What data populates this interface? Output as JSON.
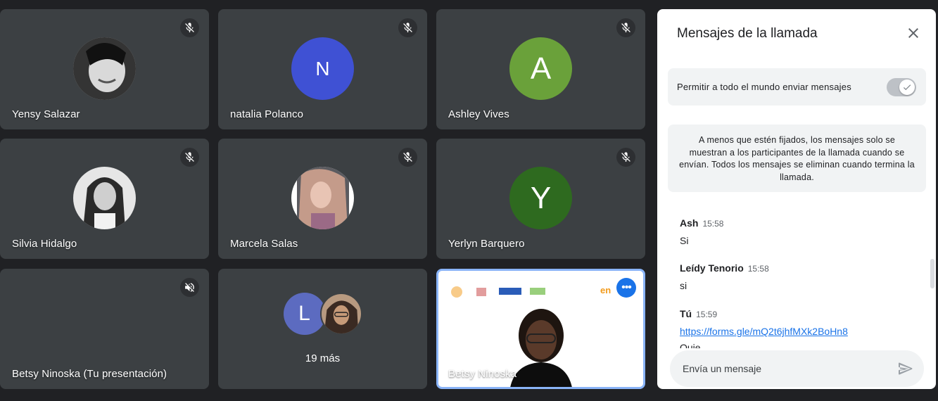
{
  "participants": [
    {
      "name": "Yensy Salazar",
      "avatar": "photo"
    },
    {
      "name": "natalia Polanco",
      "avatar_letter": "N",
      "avatar_color": "#3f51d4"
    },
    {
      "name": "Ashley Vives",
      "avatar_letter": "A",
      "avatar_color": "#6aa13a"
    },
    {
      "name": "Silvia Hidalgo",
      "avatar": "photo"
    },
    {
      "name": "Marcela Salas",
      "avatar": "photo"
    },
    {
      "name": "Yerlyn Barquero",
      "avatar_letter": "Y",
      "avatar_color": "#2e6a1f"
    },
    {
      "name": "Betsy Ninoska (Tu presentación)",
      "muted_icon": "speaker-muted-icon"
    }
  ],
  "more": {
    "letter": "L",
    "letter_color": "#5c6bc0",
    "label": "19 más"
  },
  "self_tile": {
    "name": "Betsy Ninoska"
  },
  "panel": {
    "title": "Mensajes de la llamada",
    "toggle_label": "Permitir a todo el mundo enviar mensajes",
    "toggle_on": true,
    "info": "A menos que estén fijados, los mensajes solo se muestran a los participantes de la llamada cuando se envían. Todos los mensajes se eliminan cuando termina la llamada.",
    "messages": [
      {
        "sender": "Ash",
        "time": "15:58",
        "text": "Si"
      },
      {
        "sender": "Leídy Tenorio",
        "time": "15:58",
        "text": "si"
      },
      {
        "sender": "Tú",
        "time": "15:59",
        "link": "https://forms.gle/mQ2t6jhfMXk2BoHn8",
        "text_partial": "Quie"
      }
    ],
    "input_placeholder": "Envía un mensaje"
  },
  "colors": {
    "background": "#202124",
    "tile": "#3c4043",
    "accent": "#1a73e8"
  }
}
